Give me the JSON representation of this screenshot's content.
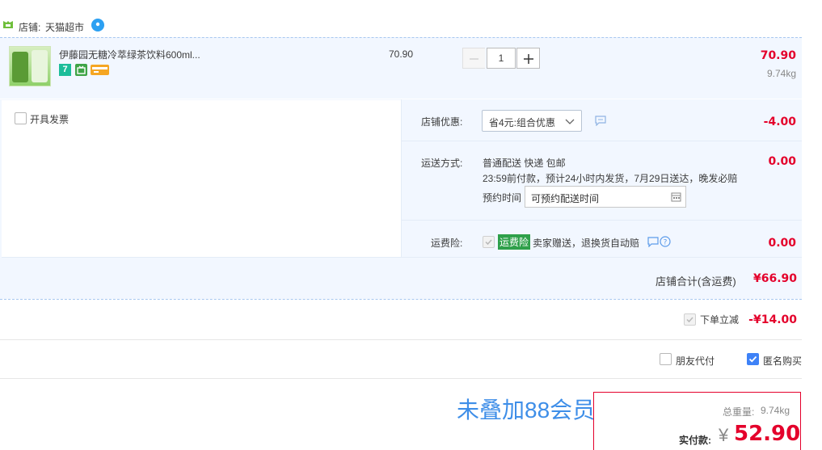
{
  "shop": {
    "prefix": "店铺:",
    "name": "天猫超市"
  },
  "item": {
    "title": "伊藤园无糖冷萃绿茶饮料600ml...",
    "unit_price": "70.90",
    "quantity": "1",
    "total": "70.90",
    "weight": "9.74kg",
    "badge_7": "7"
  },
  "invoice": {
    "label": "开具发票"
  },
  "shop_discount": {
    "label": "店铺优惠:",
    "selected": "省4元:组合优惠",
    "amount": "-4.00"
  },
  "delivery": {
    "label": "运送方式:",
    "method": "普通配送 快递 包邮",
    "detail": "23:59前付款，预计24小时内发货，7月29日送达，晚发必赔",
    "appoint_label": "预约时间",
    "appoint_placeholder": "可预约配送时间",
    "fee": "0.00"
  },
  "insurance": {
    "label": "运费险:",
    "tag": "运费险",
    "desc": "卖家赠送，退换货自动赔",
    "fee": "0.00"
  },
  "shop_total": {
    "label": "店铺合计(含运费)",
    "amount": "¥66.90"
  },
  "instant": {
    "label": "下单立减",
    "amount": "-¥14.00"
  },
  "friend_pay": {
    "label": "朋友代付"
  },
  "anonymous": {
    "label": "匿名购买"
  },
  "summary": {
    "note": "未叠加88会员折扣",
    "weight_label": "总重量:",
    "weight": "9.74kg",
    "pay_label": "实付款:",
    "currency": "¥",
    "amount": "52.90"
  },
  "colors": {
    "accent_red": "#ff0036",
    "blue_border": "#b2d1ff",
    "row_bg": "#f2f7ff",
    "note_blue": "#3e8ee8"
  }
}
